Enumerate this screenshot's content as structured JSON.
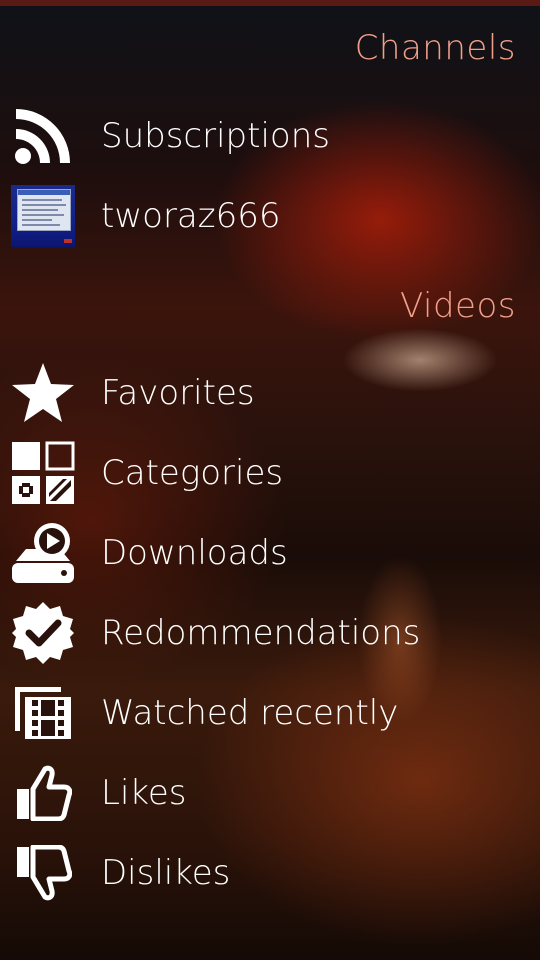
{
  "sections": {
    "channels": "Channels",
    "videos": "Videos"
  },
  "channels": [
    {
      "label": "Subscriptions",
      "icon": "rss-icon"
    },
    {
      "label": "tworaz666",
      "icon": "channel-thumbnail"
    }
  ],
  "videos": [
    {
      "label": "Favorites",
      "icon": "star-icon"
    },
    {
      "label": "Categories",
      "icon": "categories-icon"
    },
    {
      "label": "Downloads",
      "icon": "download-drive-icon"
    },
    {
      "label": "Redommendations",
      "icon": "check-badge-icon"
    },
    {
      "label": "Watched recently",
      "icon": "film-history-icon"
    },
    {
      "label": "Likes",
      "icon": "thumbs-up-icon"
    },
    {
      "label": "Dislikes",
      "icon": "thumbs-down-icon"
    }
  ],
  "colors": {
    "section_header": "#f0a08a",
    "label": "#ffffff"
  }
}
